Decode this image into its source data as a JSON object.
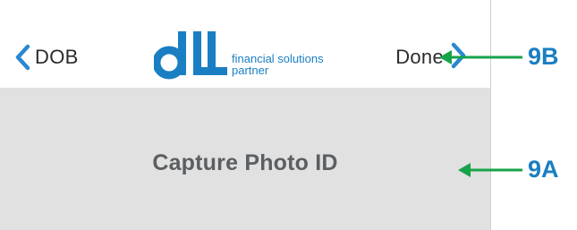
{
  "nav": {
    "back_label": "DOB",
    "done_label": "Done",
    "chevron_color": "#2a88d0"
  },
  "logo": {
    "mark_text": "dLL",
    "tagline_line1": "financial solutions",
    "tagline_line2": "partner",
    "brand_color": "#1a7fc2"
  },
  "content": {
    "title": "Capture Photo ID",
    "background": "#e1e1e1"
  },
  "callouts": [
    {
      "tag": "9B",
      "arrow_color": "#17a34a",
      "tag_color": "#1a7fc2"
    },
    {
      "tag": "9A",
      "arrow_color": "#17a34a",
      "tag_color": "#1a7fc2"
    }
  ]
}
